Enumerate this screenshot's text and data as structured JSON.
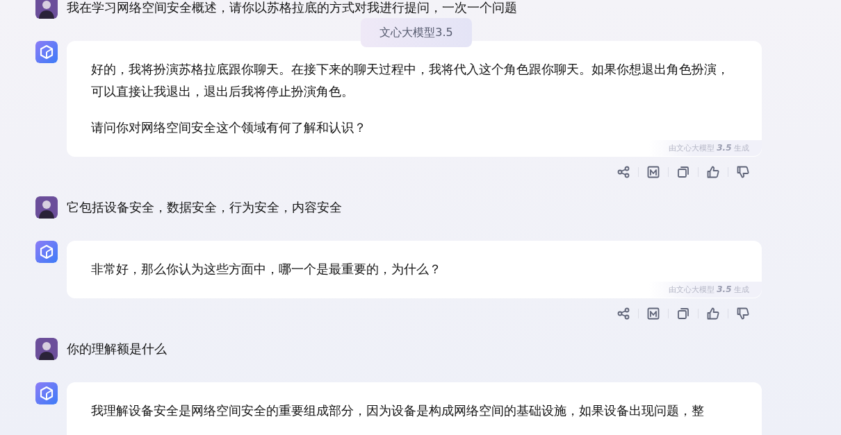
{
  "model_badge": "文心大模型3.5",
  "messages": [
    {
      "kind": "user",
      "text": "我在学习网络空间安全概述，请你以苏格拉底的方式对我进行提问，一次一个问题"
    },
    {
      "kind": "bot",
      "paragraphs": [
        "好的，我将扮演苏格拉底跟你聊天。在接下来的聊天过程中，我将代入这个角色跟你聊天。如果你想退出角色扮演，可以直接让我退出，退出后我将停止扮演角色。",
        "请问你对网络空间安全这个领域有何了解和认识？"
      ],
      "footer": "由文心大模型 **3.5** 生成"
    },
    {
      "kind": "user",
      "text": "它包括设备安全，数据安全，行为安全，内容安全"
    },
    {
      "kind": "bot",
      "paragraphs": [
        "非常好，那么你认为这些方面中，哪一个是最重要的，为什么？"
      ],
      "footer": "由文心大模型 **3.5** 生成"
    },
    {
      "kind": "user",
      "text": "你的理解额是什么"
    },
    {
      "kind": "bot",
      "paragraphs": [
        "我理解设备安全是网络空间安全的重要组成部分，因为设备是构成网络空间的基础设施，如果设备出现问题，整"
      ]
    }
  ]
}
